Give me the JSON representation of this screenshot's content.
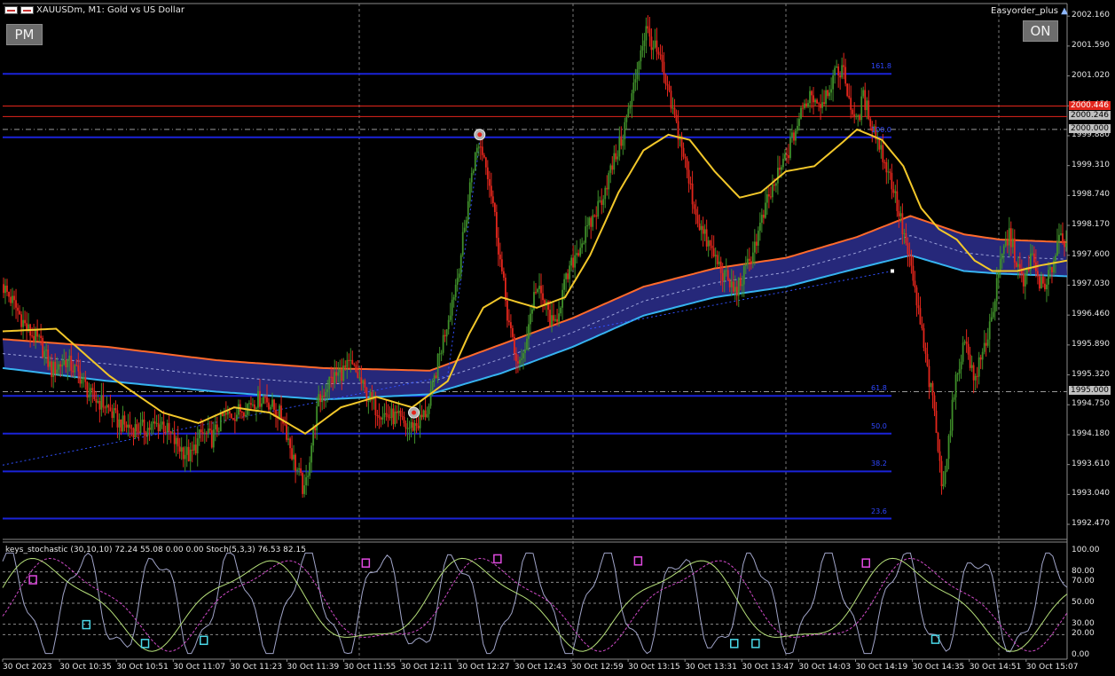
{
  "header": {
    "flag_icon": "chart-window-icon",
    "symbol": "XAUUSDm, M1:  Gold vs US Dollar",
    "expert": "Easyorder_plus",
    "expert_icon": "hat-icon"
  },
  "buttons": {
    "pm": "PM",
    "on": "ON"
  },
  "colors": {
    "background": "#000000",
    "bull": "#3f8f2a",
    "bear": "#e3261c",
    "fib": "#1a23d8",
    "ma_yellow": "#f2c72a",
    "band_fill": "#26287a",
    "band_upper": "#ff6a2c",
    "band_lower": "#36b3f0",
    "price_red": "#e3261c"
  },
  "price_axis": [
    "2002.160",
    "2001.590",
    "2001.020",
    "2000.450",
    "1999.880",
    "1999.310",
    "1998.740",
    "1998.170",
    "1997.600",
    "1997.030",
    "1996.460",
    "1995.890",
    "1995.320",
    "1994.750",
    "1994.180",
    "1993.610",
    "1993.040",
    "1992.470"
  ],
  "price_tags": [
    {
      "value": "2000.446",
      "color": "#e3261c",
      "text": "#ffffff"
    },
    {
      "value": "2000.246",
      "color": "#c0c0c0",
      "text": "#000000"
    },
    {
      "value": "2000.000",
      "color": "#c0c0c0",
      "text": "#000000"
    },
    {
      "value": "1995.000",
      "color": "#c0c0c0",
      "text": "#000000"
    }
  ],
  "fib_labels": [
    "161.8",
    "100.0",
    "61.8",
    "50.0",
    "38.2",
    "23.6"
  ],
  "indicator": {
    "label": "keys_stochastic (30,10,10) 72.24 55.08 0.00 0.00 Stoch(5,3,3) 76.53 82.15",
    "axis": [
      "100.00",
      "80.00",
      "70.00",
      "50.00",
      "30.00",
      "20.00",
      "0.00"
    ]
  },
  "time_axis": [
    "30 Oct 2023",
    "30 Oct 10:35",
    "30 Oct 10:51",
    "30 Oct 11:07",
    "30 Oct 11:23",
    "30 Oct 11:39",
    "30 Oct 11:55",
    "30 Oct 12:11",
    "30 Oct 12:27",
    "30 Oct 12:43",
    "30 Oct 12:59",
    "30 Oct 13:15",
    "30 Oct 13:31",
    "30 Oct 13:47",
    "30 Oct 14:03",
    "30 Oct 14:19",
    "30 Oct 14:35",
    "30 Oct 14:51",
    "30 Oct 15:07"
  ],
  "chart_data": {
    "type": "candlestick",
    "symbol": "XAUUSDm",
    "timeframe": "M1",
    "x_range": [
      "30 Oct 10:19",
      "30 Oct 15:13"
    ],
    "ylim": [
      1992.2,
      2002.4
    ],
    "fib_levels": [
      {
        "label": "161.8",
        "price": 2001.06
      },
      {
        "label": "100.0",
        "price": 1999.85
      },
      {
        "label": "61.8",
        "price": 1994.92
      },
      {
        "label": "50.0",
        "price": 1994.2
      },
      {
        "label": "38.2",
        "price": 1993.48
      },
      {
        "label": "23.6",
        "price": 1992.58
      }
    ],
    "horizontal_lines": [
      {
        "price": 2000.446,
        "color": "#e3261c"
      },
      {
        "price": 2000.246,
        "color": "#e3261c"
      },
      {
        "price": 2000.0,
        "style": "dash-dot"
      },
      {
        "price": 1995.0,
        "style": "dash-dot"
      }
    ],
    "close_path": [
      [
        0,
        1997.05
      ],
      [
        8,
        1996.6
      ],
      [
        14,
        1996.2
      ],
      [
        22,
        1995.9
      ],
      [
        28,
        1995.4
      ],
      [
        36,
        1995.6
      ],
      [
        44,
        1995.3
      ],
      [
        50,
        1994.9
      ],
      [
        58,
        1994.75
      ],
      [
        66,
        1994.4
      ],
      [
        74,
        1994.3
      ],
      [
        82,
        1994.3
      ],
      [
        90,
        1994.4
      ],
      [
        98,
        1994.0
      ],
      [
        106,
        1993.75
      ],
      [
        112,
        1994.2
      ],
      [
        118,
        1994.1
      ],
      [
        124,
        1994.5
      ],
      [
        132,
        1994.6
      ],
      [
        140,
        1994.8
      ],
      [
        148,
        1994.9
      ],
      [
        152,
        1994.7
      ],
      [
        158,
        1994.5
      ],
      [
        164,
        1993.7
      ],
      [
        168,
        1993.3
      ],
      [
        170,
        1993.05
      ],
      [
        174,
        1994.0
      ],
      [
        178,
        1994.8
      ],
      [
        184,
        1995.2
      ],
      [
        190,
        1995.35
      ],
      [
        196,
        1995.5
      ],
      [
        200,
        1995.3
      ],
      [
        204,
        1995.0
      ],
      [
        210,
        1994.7
      ],
      [
        216,
        1994.55
      ],
      [
        222,
        1994.5
      ],
      [
        228,
        1994.3
      ],
      [
        234,
        1994.4
      ],
      [
        240,
        1994.7
      ],
      [
        244,
        1995.4
      ],
      [
        248,
        1996.0
      ],
      [
        252,
        1996.6
      ],
      [
        256,
        1997.2
      ],
      [
        260,
        1998.1
      ],
      [
        264,
        1999.2
      ],
      [
        268,
        1999.75
      ],
      [
        272,
        1999.4
      ],
      [
        276,
        1998.6
      ],
      [
        280,
        1997.5
      ],
      [
        284,
        1996.5
      ],
      [
        288,
        1995.7
      ],
      [
        292,
        1995.5
      ],
      [
        296,
        1996.3
      ],
      [
        300,
        1997.0
      ],
      [
        306,
        1996.6
      ],
      [
        310,
        1996.2
      ],
      [
        316,
        1997.0
      ],
      [
        322,
        1997.6
      ],
      [
        328,
        1998.0
      ],
      [
        336,
        1998.6
      ],
      [
        342,
        1999.2
      ],
      [
        348,
        1999.8
      ],
      [
        354,
        2000.6
      ],
      [
        358,
        2001.4
      ],
      [
        362,
        2001.9
      ],
      [
        366,
        2001.6
      ],
      [
        370,
        2001.3
      ],
      [
        374,
        2000.7
      ],
      [
        378,
        2000.2
      ],
      [
        382,
        1999.7
      ],
      [
        386,
        1999.0
      ],
      [
        390,
        1998.4
      ],
      [
        394,
        1998.0
      ],
      [
        400,
        1997.6
      ],
      [
        406,
        1997.2
      ],
      [
        412,
        1996.9
      ],
      [
        418,
        1997.3
      ],
      [
        424,
        1997.9
      ],
      [
        430,
        1998.6
      ],
      [
        436,
        1999.1
      ],
      [
        442,
        1999.6
      ],
      [
        448,
        2000.2
      ],
      [
        454,
        2000.7
      ],
      [
        460,
        2000.5
      ],
      [
        466,
        2000.9
      ],
      [
        472,
        2001.2
      ],
      [
        476,
        2000.6
      ],
      [
        480,
        2000.1
      ],
      [
        484,
        2000.6
      ],
      [
        488,
        2000.2
      ],
      [
        494,
        1999.6
      ],
      [
        500,
        1999.0
      ],
      [
        504,
        1998.4
      ],
      [
        508,
        1997.8
      ],
      [
        512,
        1997.1
      ],
      [
        516,
        1996.3
      ],
      [
        520,
        1995.4
      ],
      [
        524,
        1994.6
      ],
      [
        526,
        1993.9
      ],
      [
        528,
        1993.2
      ],
      [
        531,
        1993.8
      ],
      [
        534,
        1994.7
      ],
      [
        538,
        1995.6
      ],
      [
        542,
        1996.0
      ],
      [
        546,
        1995.2
      ],
      [
        550,
        1995.6
      ],
      [
        554,
        1996.1
      ],
      [
        558,
        1996.8
      ],
      [
        562,
        1997.6
      ],
      [
        566,
        1998.0
      ],
      [
        570,
        1997.5
      ],
      [
        574,
        1997.0
      ],
      [
        578,
        1997.6
      ],
      [
        582,
        1997.2
      ],
      [
        586,
        1996.9
      ],
      [
        590,
        1997.4
      ],
      [
        594,
        1998.0
      ],
      [
        598,
        1997.9
      ]
    ],
    "ma_yellow": [
      [
        0,
        1996.15
      ],
      [
        30,
        1996.2
      ],
      [
        60,
        1995.3
      ],
      [
        90,
        1994.6
      ],
      [
        110,
        1994.4
      ],
      [
        130,
        1994.7
      ],
      [
        150,
        1994.6
      ],
      [
        170,
        1994.2
      ],
      [
        190,
        1994.7
      ],
      [
        210,
        1994.9
      ],
      [
        230,
        1994.7
      ],
      [
        250,
        1995.2
      ],
      [
        262,
        1996.1
      ],
      [
        270,
        1996.6
      ],
      [
        280,
        1996.8
      ],
      [
        300,
        1996.6
      ],
      [
        316,
        1996.8
      ],
      [
        330,
        1997.6
      ],
      [
        346,
        1998.8
      ],
      [
        360,
        1999.6
      ],
      [
        374,
        1999.9
      ],
      [
        386,
        1999.8
      ],
      [
        400,
        1999.2
      ],
      [
        414,
        1998.7
      ],
      [
        426,
        1998.8
      ],
      [
        440,
        1999.2
      ],
      [
        456,
        1999.3
      ],
      [
        470,
        1999.7
      ],
      [
        480,
        2000.0
      ],
      [
        494,
        1999.8
      ],
      [
        506,
        1999.3
      ],
      [
        516,
        1998.5
      ],
      [
        526,
        1998.1
      ],
      [
        536,
        1997.9
      ],
      [
        546,
        1997.5
      ],
      [
        556,
        1997.3
      ],
      [
        570,
        1997.3
      ],
      [
        582,
        1997.4
      ],
      [
        598,
        1997.5
      ]
    ],
    "band_upper": [
      [
        0,
        1996.0
      ],
      [
        60,
        1995.85
      ],
      [
        120,
        1995.6
      ],
      [
        180,
        1995.45
      ],
      [
        240,
        1995.4
      ],
      [
        280,
        1995.9
      ],
      [
        320,
        1996.4
      ],
      [
        360,
        1997.0
      ],
      [
        400,
        1997.35
      ],
      [
        440,
        1997.55
      ],
      [
        480,
        1997.95
      ],
      [
        510,
        1998.35
      ],
      [
        540,
        1998.0
      ],
      [
        560,
        1997.9
      ],
      [
        598,
        1997.85
      ]
    ],
    "band_lower": [
      [
        0,
        1995.45
      ],
      [
        60,
        1995.2
      ],
      [
        120,
        1995.0
      ],
      [
        180,
        1994.85
      ],
      [
        240,
        1994.95
      ],
      [
        280,
        1995.35
      ],
      [
        320,
        1995.85
      ],
      [
        360,
        1996.45
      ],
      [
        400,
        1996.8
      ],
      [
        440,
        1997.0
      ],
      [
        480,
        1997.35
      ],
      [
        510,
        1997.6
      ],
      [
        540,
        1997.3
      ],
      [
        560,
        1997.25
      ],
      [
        598,
        1997.2
      ]
    ],
    "stochastic": {
      "params": "(30,10,10)",
      "values": [
        72.24,
        55.08,
        0.0,
        0.0
      ],
      "fast_params": "(5,3,3)",
      "fast_values": [
        76.53,
        82.15
      ],
      "levels": [
        80,
        70,
        50,
        30,
        20
      ]
    }
  }
}
